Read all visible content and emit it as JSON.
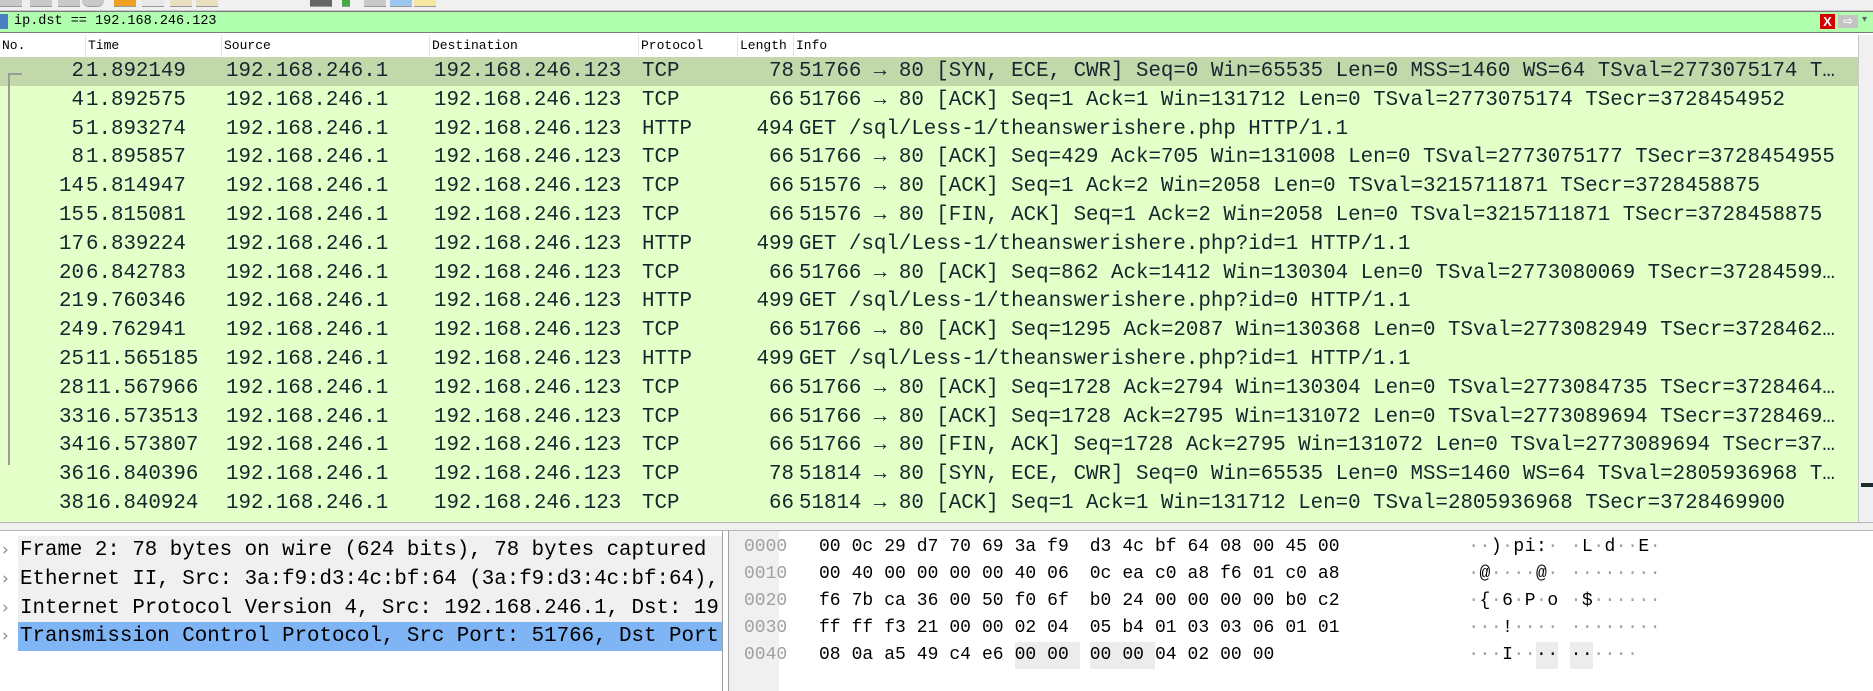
{
  "filter": {
    "value": "ip.dst == 192.168.246.123",
    "clear_label": "X",
    "apply_label": "⇨",
    "dropdown_label": "▾"
  },
  "colors": {
    "filter_valid": "#afffaf",
    "row_tcp_http": "#e4ffc7",
    "row_selected": "#c3d8aa",
    "detail_selected": "#7fb4f5"
  },
  "columns": [
    "No.",
    "Time",
    "Source",
    "Destination",
    "Protocol",
    "Length",
    "Info"
  ],
  "selected_packet": "2",
  "packets": [
    {
      "no": "2",
      "time": "1.892149",
      "src": "192.168.246.1",
      "dst": "192.168.246.123",
      "proto": "TCP",
      "len": "78",
      "info": "51766 → 80 [SYN, ECE, CWR] Seq=0 Win=65535 Len=0 MSS=1460 WS=64 TSval=2773075174 T…"
    },
    {
      "no": "4",
      "time": "1.892575",
      "src": "192.168.246.1",
      "dst": "192.168.246.123",
      "proto": "TCP",
      "len": "66",
      "info": "51766 → 80 [ACK] Seq=1 Ack=1 Win=131712 Len=0 TSval=2773075174 TSecr=3728454952"
    },
    {
      "no": "5",
      "time": "1.893274",
      "src": "192.168.246.1",
      "dst": "192.168.246.123",
      "proto": "HTTP",
      "len": "494",
      "info": "GET /sql/Less-1/theanswerishere.php HTTP/1.1"
    },
    {
      "no": "8",
      "time": "1.895857",
      "src": "192.168.246.1",
      "dst": "192.168.246.123",
      "proto": "TCP",
      "len": "66",
      "info": "51766 → 80 [ACK] Seq=429 Ack=705 Win=131008 Len=0 TSval=2773075177 TSecr=3728454955"
    },
    {
      "no": "14",
      "time": "5.814947",
      "src": "192.168.246.1",
      "dst": "192.168.246.123",
      "proto": "TCP",
      "len": "66",
      "info": "51576 → 80 [ACK] Seq=1 Ack=2 Win=2058 Len=0 TSval=3215711871 TSecr=3728458875"
    },
    {
      "no": "15",
      "time": "5.815081",
      "src": "192.168.246.1",
      "dst": "192.168.246.123",
      "proto": "TCP",
      "len": "66",
      "info": "51576 → 80 [FIN, ACK] Seq=1 Ack=2 Win=2058 Len=0 TSval=3215711871 TSecr=3728458875"
    },
    {
      "no": "17",
      "time": "6.839224",
      "src": "192.168.246.1",
      "dst": "192.168.246.123",
      "proto": "HTTP",
      "len": "499",
      "info": "GET /sql/Less-1/theanswerishere.php?id=1 HTTP/1.1"
    },
    {
      "no": "20",
      "time": "6.842783",
      "src": "192.168.246.1",
      "dst": "192.168.246.123",
      "proto": "TCP",
      "len": "66",
      "info": "51766 → 80 [ACK] Seq=862 Ack=1412 Win=130304 Len=0 TSval=2773080069 TSecr=37284599…"
    },
    {
      "no": "21",
      "time": "9.760346",
      "src": "192.168.246.1",
      "dst": "192.168.246.123",
      "proto": "HTTP",
      "len": "499",
      "info": "GET /sql/Less-1/theanswerishere.php?id=0 HTTP/1.1"
    },
    {
      "no": "24",
      "time": "9.762941",
      "src": "192.168.246.1",
      "dst": "192.168.246.123",
      "proto": "TCP",
      "len": "66",
      "info": "51766 → 80 [ACK] Seq=1295 Ack=2087 Win=130368 Len=0 TSval=2773082949 TSecr=3728462…"
    },
    {
      "no": "25",
      "time": "11.565185",
      "src": "192.168.246.1",
      "dst": "192.168.246.123",
      "proto": "HTTP",
      "len": "499",
      "info": "GET /sql/Less-1/theanswerishere.php?id=1 HTTP/1.1"
    },
    {
      "no": "28",
      "time": "11.567966",
      "src": "192.168.246.1",
      "dst": "192.168.246.123",
      "proto": "TCP",
      "len": "66",
      "info": "51766 → 80 [ACK] Seq=1728 Ack=2794 Win=130304 Len=0 TSval=2773084735 TSecr=3728464…"
    },
    {
      "no": "33",
      "time": "16.573513",
      "src": "192.168.246.1",
      "dst": "192.168.246.123",
      "proto": "TCP",
      "len": "66",
      "info": "51766 → 80 [ACK] Seq=1728 Ack=2795 Win=131072 Len=0 TSval=2773089694 TSecr=3728469…"
    },
    {
      "no": "34",
      "time": "16.573807",
      "src": "192.168.246.1",
      "dst": "192.168.246.123",
      "proto": "TCP",
      "len": "66",
      "info": "51766 → 80 [FIN, ACK] Seq=1728 Ack=2795 Win=131072 Len=0 TSval=2773089694 TSecr=37…"
    },
    {
      "no": "36",
      "time": "16.840396",
      "src": "192.168.246.1",
      "dst": "192.168.246.123",
      "proto": "TCP",
      "len": "78",
      "info": "51814 → 80 [SYN, ECE, CWR] Seq=0 Win=65535 Len=0 MSS=1460 WS=64 TSval=2805936968 T…"
    },
    {
      "no": "38",
      "time": "16.840924",
      "src": "192.168.246.1",
      "dst": "192.168.246.123",
      "proto": "TCP",
      "len": "66",
      "info": "51814 → 80 [ACK] Seq=1 Ack=1 Win=131712 Len=0 TSval=2805936968 TSecr=3728469900"
    }
  ],
  "details": [
    {
      "text": "Frame 2: 78 bytes on wire (624 bits), 78 bytes captured",
      "selected": false
    },
    {
      "text": "Ethernet II, Src: 3a:f9:d3:4c:bf:64 (3a:f9:d3:4c:bf:64),",
      "selected": false
    },
    {
      "text": "Internet Protocol Version 4, Src: 192.168.246.1, Dst: 19",
      "selected": false
    },
    {
      "text": "Transmission Control Protocol, Src Port: 51766, Dst Port",
      "selected": true
    }
  ],
  "expander_icon": "›",
  "hex": [
    {
      "offset": "0000",
      "bytes": [
        "00",
        "0c",
        "29",
        "d7",
        "70",
        "69",
        "3a",
        "f9",
        "d3",
        "4c",
        "bf",
        "64",
        "08",
        "00",
        "45",
        "00"
      ],
      "ascii": "··)·pi:··L·d··E·"
    },
    {
      "offset": "0010",
      "bytes": [
        "00",
        "40",
        "00",
        "00",
        "00",
        "00",
        "40",
        "06",
        "0c",
        "ea",
        "c0",
        "a8",
        "f6",
        "01",
        "c0",
        "a8"
      ],
      "ascii": "·@····@·········"
    },
    {
      "offset": "0020",
      "bytes": [
        "f6",
        "7b",
        "ca",
        "36",
        "00",
        "50",
        "f0",
        "6f",
        "b0",
        "24",
        "00",
        "00",
        "00",
        "00",
        "b0",
        "c2"
      ],
      "ascii": "·{·6·P·o·$······"
    },
    {
      "offset": "0030",
      "bytes": [
        "ff",
        "ff",
        "f3",
        "21",
        "00",
        "00",
        "02",
        "04",
        "05",
        "b4",
        "01",
        "03",
        "03",
        "06",
        "01",
        "01"
      ],
      "ascii": "···!············"
    },
    {
      "offset": "0040",
      "bytes": [
        "08",
        "0a",
        "a5",
        "49",
        "c4",
        "e6",
        "00",
        "00",
        "00",
        "00",
        "04",
        "02",
        "00",
        "00"
      ],
      "ascii": "···I··········",
      "highlight": [
        6,
        7,
        8,
        9
      ]
    }
  ]
}
